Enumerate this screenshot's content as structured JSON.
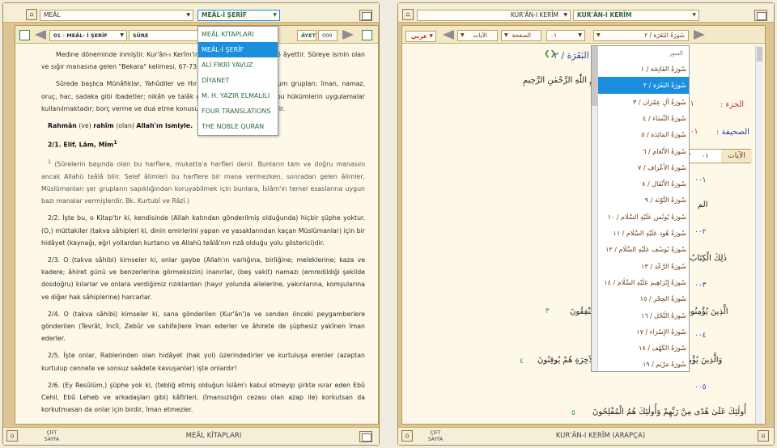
{
  "left": {
    "top_select": "MEÂL",
    "top_select2": "MEÂL-İ ŞERÎF",
    "sure_select": "01 - MEÂL- İ ŞERÎF",
    "sure_label": "SÛRE",
    "ayet_label": "ÂYET",
    "ayet_value": "000",
    "dropdown": [
      "MEÂL KİTAPLARI",
      "MEÂL-İ ŞERÎF",
      "ALİ FİKRİ YAVUZ",
      "DİYANET",
      "M. H. YAZIR ELMALILI",
      "FOUR TRANSLATIONS",
      "THE NOBLE QURAN"
    ],
    "paragraphs": [
      "Medine döneminde inmiştir. Kur'ân-ı Kerîm'in en uzun sûresi olup, 286 âyettir. Sûreye ismin olan ve sığır manasına gelen \"Bekara\" kelimesi, 67-73. âyetlerde geçmektedir.",
      "Sûrede başlıca Münâfıklar, Yahûdiler ve Hıristiyanlar gibi çeşitli toplum grupları; îman, namaz, oruç, hac, sadaka gibi ibadetler; nikâh ve talâk gibi hukukî hükümler ve bu hükümlerin uygulamalar kullanılmaktadır; borç verme ve dua etme konusunda ölçüler bildirilmektedir."
    ],
    "basmala_a": "Rahmân",
    "basmala_b": "(ve)",
    "basmala_c": "rahîm",
    "basmala_d": "(olan)",
    "basmala_e": "Allah'ın ismiyle.",
    "v1_text": "2/1. Elif, Lâm, Mîm",
    "v1_sup": "1",
    "fn1_num": "1",
    "fn1": "(Sûrelerin başında olan bu harflere, mukatta'a harfleri denir. Bunların tam ve doğru manasını ancak Allahü teâlâ bilir. Selef âlimleri bu harflere bir mana vermezken, sonradan gelen âlimler, Müslümanları şer grupların sapıklığından koruyabilmek için bunlara, İslâm'ın temel esaslarına uygun bazı manalar vermişlerdir. Bk. Kurtubî ve Râzî.)",
    "v2": "2/2. İşte bu, o Kitap'tır ki, kendisinde (Allah katından gönderilmiş olduğunda) hiçbir şüphe yoktur. (O,) müttakiler (takva sâhipleri ki, dinin emirlerini yapan ve yasaklarından kaçan Müslümanlar) için bir hidâyet (kaynağı, eğri yollardan kurtarıcı ve Allahü teâlâ'nın rızâ olduğu yolu gösterici)dir.",
    "v3": "2/3. O (takva sâhibi) kimseler ki, onlar gaybe (Allah'ın varlığına, birliğine; meleklerine; kaza ve kadere; âhiret günü ve benzerlerine görmeksizin) inanırlar, (beş vakit) namazı (emredildiği şekilde dosdoğru) kılarlar ve onlara verdiğimiz rızıklardan (hayır yolunda ailelerine, yakınlarına, komşularına ve diğer hak sâhiplerine) harcarlar.",
    "v4": "2/4. O (takva sâhibi) kimseler ki, sana gönderilen (Kur'ân')a ve senden önceki peygamberlere gönderilen (Tevrât, İncîl, Zebûr ve sahife)lere îman ederler ve âhirete de şüphesiz yakînen îman ederler.",
    "v5": "2/5. İşte onlar, Rablerinden olan hidâyet (hak yol) üzerindedirler ve kurtuluşa erenler (azaptan kurtulup cennete ve sonsuz saâdete kavuşanlar) işte onlardır!",
    "v6": "2/6. (Ey Resûlüm,) şüphe yok ki, (tebliğ etmiş olduğun İslâm'ı kabul etmeyip şirkte ısrar eden Ebû Cehil, Ebû Leheb ve arkadaşları gibi) kâfirleri, (îmansızlığın cezası olan azap ile) korkutsan da korkutmasan da onlar için birdir, îman etmezler.",
    "footer_btn": "ÇİFT SAYFA",
    "footer_title": "MEÂL KİTAPLARI"
  },
  "right": {
    "top_select": "KUR'ÂN-I KERÎM",
    "top_select2": "KUR'ÂN-I KERÎM",
    "lang": "عربي",
    "ayat_label": "الآيات",
    "page_label": "الصفحة",
    "juz_value": "٠١",
    "surah_sel": "سُورَةُ البَقَرَة / ٢",
    "surah_header": "سُورَةُ البَقَرَة / ٢",
    "basmala": "بِسْمِ اللّٰهِ الرَّحْمٰنِ الرَّحِيمِ",
    "juz_label": "الجزء :",
    "juz_num": "٠١",
    "page_label2": "الصحيفة :",
    "page_num": "٠٠١",
    "ayat_box": "الآيات",
    "ayat_n1": "٠١",
    "ayat_n2": "٠٢",
    "surah_list_title": "السور",
    "surahs": [
      "سُورَةُ الفَاتِحَة / ١",
      "سُورَةُ البَقَرَة / ٢",
      "سُورَةُ آلِ عِمْرَان / ٣",
      "سُورَةُ النِّسَاء / ٤",
      "سُورَةُ المَائِدَة / ٥",
      "سُورَةُ الأَنْعَام / ٦",
      "سُورَةُ الأَعْرَاف / ٧",
      "سُورَةُ الأَنْفَال / ٨",
      "سُورَةُ التَّوْبَة / ٩",
      "سُورَةُ يُونُس عَلَيْهِ السَّلَام / ١٠",
      "سُورَةُ هُود عَلَيْهِ السَّلَام / ١١",
      "سُورَةُ يُوسُف عَلَيْهِ السَّلَام / ١٢",
      "سُورَةُ الرَّعْد / ١٣",
      "سُورَةُ إِبْرَاهِيم عَلَيْهِ السَّلَام / ١٤",
      "سُورَةُ الحِجْر / ١٥",
      "سُورَةُ النَّحْل / ١٦",
      "سُورَةُ الإِسْرَاء / ١٧",
      "سُورَةُ الكَهْف / ١٨",
      "سُورَةُ مَرْيَم / ١٩"
    ],
    "ayah_nums": [
      "٠٠١",
      "٠٠٢",
      "٠٠٣",
      "٠٠٤",
      "٠٠٥"
    ],
    "ayah_text": [
      "الم",
      "ذٰلِكَ الْكِتَابُ",
      "الَّذِينَ يُؤْمِنُونَ",
      "وَالَّذِينَ يُؤْمِنُونَ",
      "أُولٰئِكَ عَلَىٰ هُدًى مِنْ رَبِّهِمْ وَأُولٰئِكَ هُمُ الْمُفْلِحُونَ"
    ],
    "ayah_marks": [
      "٣",
      "٤",
      "٥"
    ],
    "line3": "يُنْفِقُونَ",
    "line4": "بِالْآخِرَةِ هُمْ يُوقِنُونَ",
    "footer_btn": "ÇİFT SAYFA",
    "footer_title": "KUR'ÂN-I KERÎM (ARAPÇA)"
  }
}
